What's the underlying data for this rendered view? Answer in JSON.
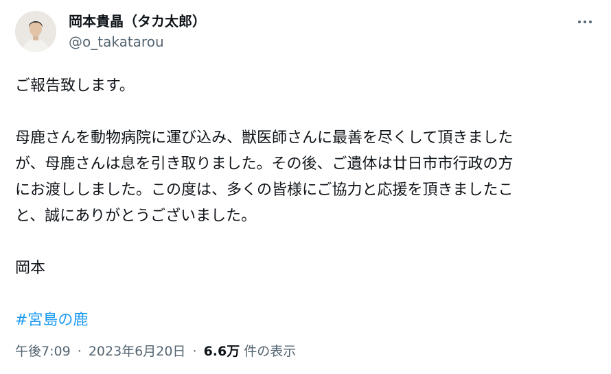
{
  "author": {
    "name": "岡本貴晶（タカ太郎）",
    "handle": "@o_takatarou",
    "avatar_icon": "profile-photo"
  },
  "more_icon": "ellipsis-icon",
  "tweet": {
    "lines": [
      "ご報告致します。",
      "",
      "母鹿さんを動物病院に運び込み、獣医師さんに最善を尽くして頂きました",
      "が、母鹿さんは息を引き取りました。その後、ご遺体は廿日市市行政の方",
      "にお渡ししました。この度は、多くの皆様にご協力と応援を頂きましたこ",
      "と、誠にありがとうございました。",
      "",
      "岡本",
      ""
    ],
    "hashtag": "#宮島の鹿"
  },
  "meta": {
    "time": "午後7:09",
    "separator": "·",
    "date": "2023年6月20日",
    "views_count": "6.6万",
    "views_label": "件の表示"
  },
  "colors": {
    "text": "#0f1419",
    "secondary": "#536471",
    "link": "#1d9bf0"
  }
}
